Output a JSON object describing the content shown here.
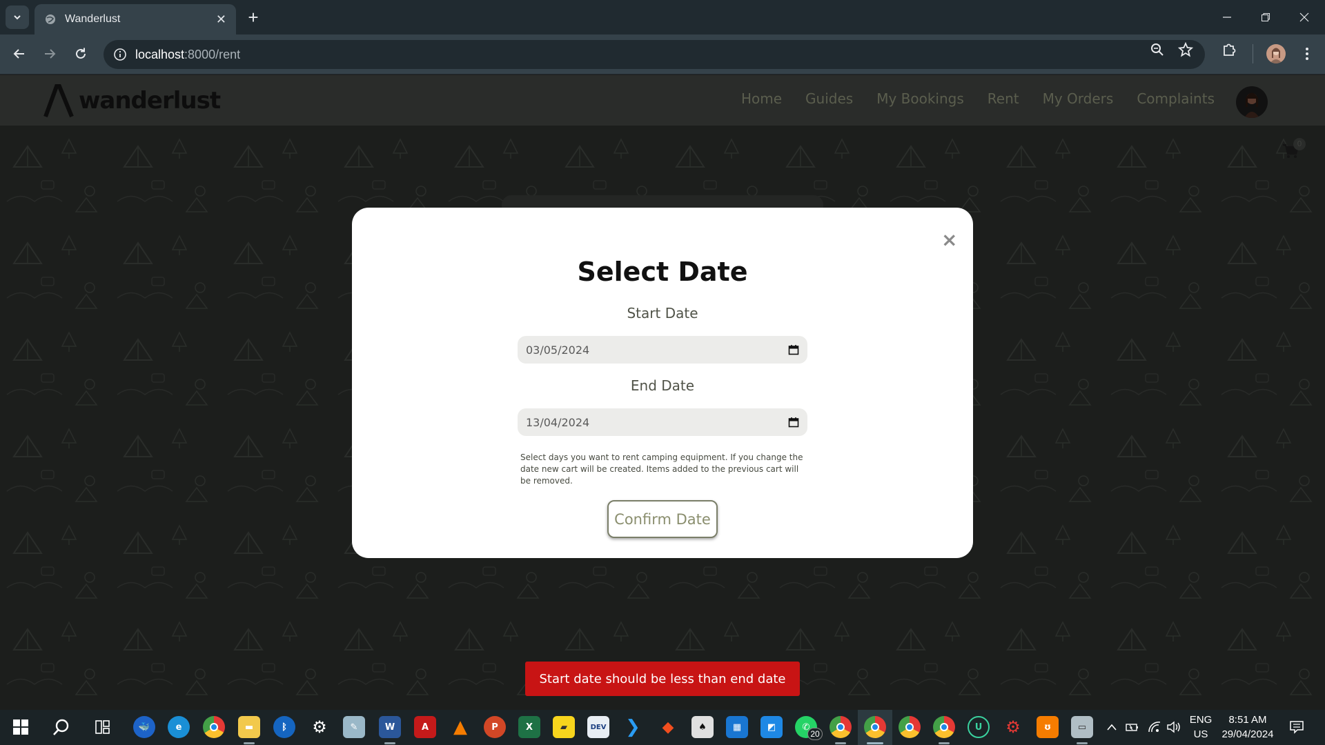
{
  "browser": {
    "tab_title": "Wanderlust",
    "url_host": "localhost",
    "url_path": ":8000/rent"
  },
  "site": {
    "logo_text": "wanderlust",
    "nav": [
      "Home",
      "Guides",
      "My Bookings",
      "Rent",
      "My Orders",
      "Complaints"
    ],
    "cart_count": "0"
  },
  "modal": {
    "close_glyph": "×",
    "title": "Select Date",
    "start_label": "Start Date",
    "start_value": "03/05/2024",
    "end_label": "End Date",
    "end_value": "13/04/2024",
    "help_text": "Select days you want to rent camping equipment. If you change the date new cart will be created. Items added to the previous cart will be removed.",
    "confirm_label": "Confirm Date"
  },
  "toast": {
    "message": "Start date should be less than end date"
  },
  "taskbar": {
    "whatsapp_badge": "20",
    "lang_line1": "ENG",
    "lang_line2": "US",
    "time": "8:51 AM",
    "date": "29/04/2024"
  },
  "colors": {
    "accent_olive": "#7a7e68",
    "toast_red": "#c81414",
    "chrome_dark": "#202a30"
  }
}
